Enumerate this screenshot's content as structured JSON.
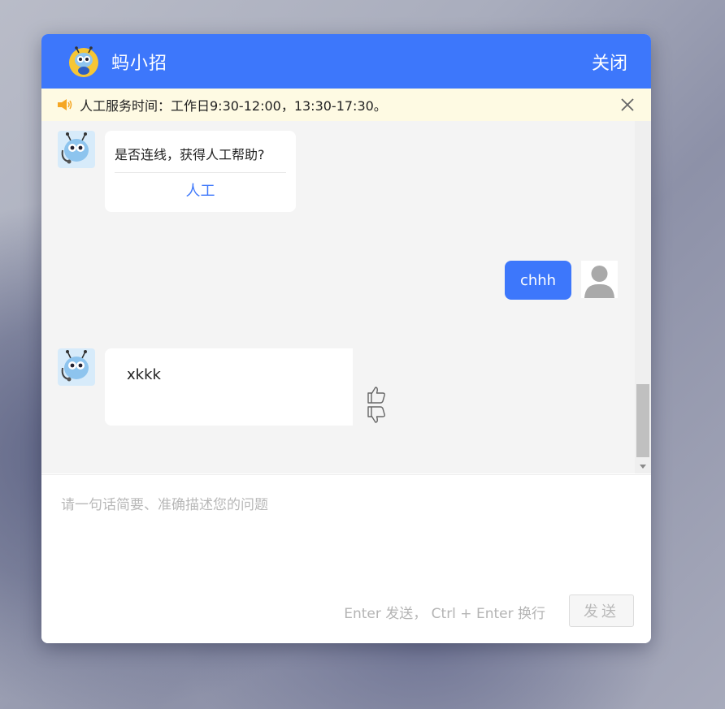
{
  "header": {
    "title": "蚂小招",
    "close_label": "关闭"
  },
  "notice": {
    "text": "人工服务时间：工作日9:30-12:00，13:30-17:30。"
  },
  "messages": {
    "bot_prompt": {
      "question": "是否连线，获得人工帮助?",
      "action": "人工"
    },
    "user_message": {
      "text": "chhh"
    },
    "bot_reply": {
      "text": "xkkk"
    }
  },
  "composer": {
    "placeholder": "请一句话简要、准确描述您的问题",
    "hint": "Enter 发送， Ctrl + Enter 换行",
    "send_label": "发送"
  },
  "colors": {
    "accent": "#3d77fb",
    "notice_bg": "#fefae3",
    "chat_bg": "#f4f4f4"
  },
  "icons": [
    "ant-mascot-logo",
    "speaker-icon",
    "close-icon",
    "bot-avatar",
    "user-avatar",
    "thumbs-up-icon",
    "thumbs-down-icon"
  ]
}
